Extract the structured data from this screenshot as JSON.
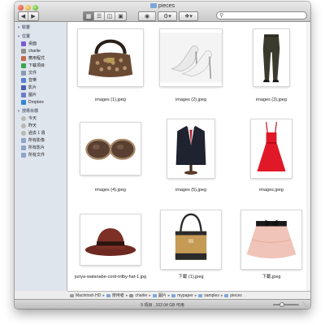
{
  "window": {
    "title": "pieces"
  },
  "sidebar": {
    "sections": [
      {
        "label": "裝置",
        "items": []
      },
      {
        "label": "位置",
        "items": [
          {
            "label": "桌面",
            "icon": "desktop-icon",
            "color": "#7a5bd6"
          },
          {
            "label": "charlie",
            "icon": "home-icon",
            "color": "#8f8f8f"
          },
          {
            "label": "應用程式",
            "icon": "applications-icon",
            "color": "#c46a4a"
          },
          {
            "label": "下載項目",
            "icon": "downloads-icon",
            "color": "#3fa34d"
          },
          {
            "label": "文件",
            "icon": "documents-icon",
            "color": "#8a9bb0"
          },
          {
            "label": "音樂",
            "icon": "music-icon",
            "color": "#5b7fd6"
          },
          {
            "label": "影片",
            "icon": "movies-icon",
            "color": "#4a5fb0"
          },
          {
            "label": "圖片",
            "icon": "pictures-icon",
            "color": "#6b7cc9"
          },
          {
            "label": "Dropbox",
            "icon": "dropbox-icon",
            "color": "#2f86d6"
          }
        ]
      },
      {
        "label": "搜尋目標",
        "items": [
          {
            "label": "今天",
            "icon": "clock-icon",
            "color": "#b8b8b8"
          },
          {
            "label": "昨天",
            "icon": "clock-icon",
            "color": "#b8b8b8"
          },
          {
            "label": "過去 1 週",
            "icon": "clock-icon",
            "color": "#b8b8b8"
          },
          {
            "label": "所有影像",
            "icon": "smart-folder-icon",
            "color": "#8fa3c9"
          },
          {
            "label": "所有影片",
            "icon": "smart-folder-icon",
            "color": "#8fa3c9"
          },
          {
            "label": "所有文件",
            "icon": "smart-folder-icon",
            "color": "#8fa3c9"
          }
        ]
      }
    ]
  },
  "files": [
    {
      "name": "images (1).jpeg",
      "subject": "handbag"
    },
    {
      "name": "images (2).jpeg",
      "subject": "heels"
    },
    {
      "name": "images (3).jpeg",
      "subject": "trousers"
    },
    {
      "name": "images (4).jpeg",
      "subject": "sunglasses"
    },
    {
      "name": "images (5).jpeg",
      "subject": "suit"
    },
    {
      "name": "images.jpeg",
      "subject": "red-dress"
    },
    {
      "name": "junya-watanabe-cord-trilby-hat-1.jpg",
      "subject": "hat"
    },
    {
      "name": "下載 (1).jpeg",
      "subject": "tote-bag"
    },
    {
      "name": "下載.jpeg",
      "subject": "tutu-skirt"
    }
  ],
  "pathbar": [
    {
      "label": "Macintosh HD",
      "icon": "hd-icon"
    },
    {
      "label": "使用者",
      "icon": "folder-icon"
    },
    {
      "label": "charlie",
      "icon": "home-icon"
    },
    {
      "label": "圖片",
      "icon": "folder-icon"
    },
    {
      "label": "mypaper",
      "icon": "folder-icon"
    },
    {
      "label": "samples",
      "icon": "folder-icon"
    },
    {
      "label": "pieces",
      "icon": "folder-icon"
    }
  ],
  "statusbar": {
    "text": "9 項目 , 102.04 GB 可用",
    "zoom_level": 0.35
  }
}
